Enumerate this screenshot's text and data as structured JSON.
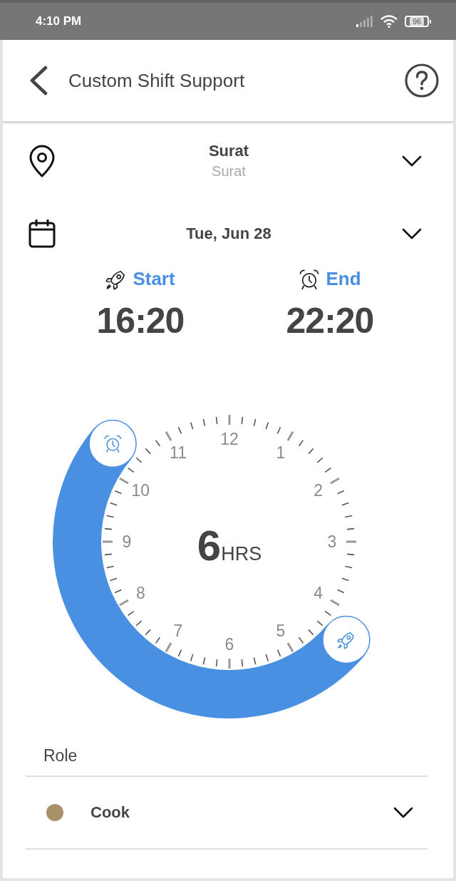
{
  "status_bar": {
    "time": "4:10 PM",
    "battery": "96"
  },
  "header": {
    "title": "Custom Shift Support"
  },
  "location": {
    "value": "Surat",
    "subtitle": "Surat"
  },
  "date": {
    "value": "Tue, Jun 28"
  },
  "start": {
    "label": "Start",
    "time": "16:20"
  },
  "end": {
    "label": "End",
    "time": "22:20"
  },
  "dial": {
    "numbers": [
      "12",
      "1",
      "2",
      "3",
      "4",
      "5",
      "6",
      "7",
      "8",
      "9",
      "10",
      "11"
    ],
    "duration": "6",
    "unit": "HRS"
  },
  "role": {
    "label": "Role",
    "value": "Cook",
    "color": "#a89069"
  }
}
